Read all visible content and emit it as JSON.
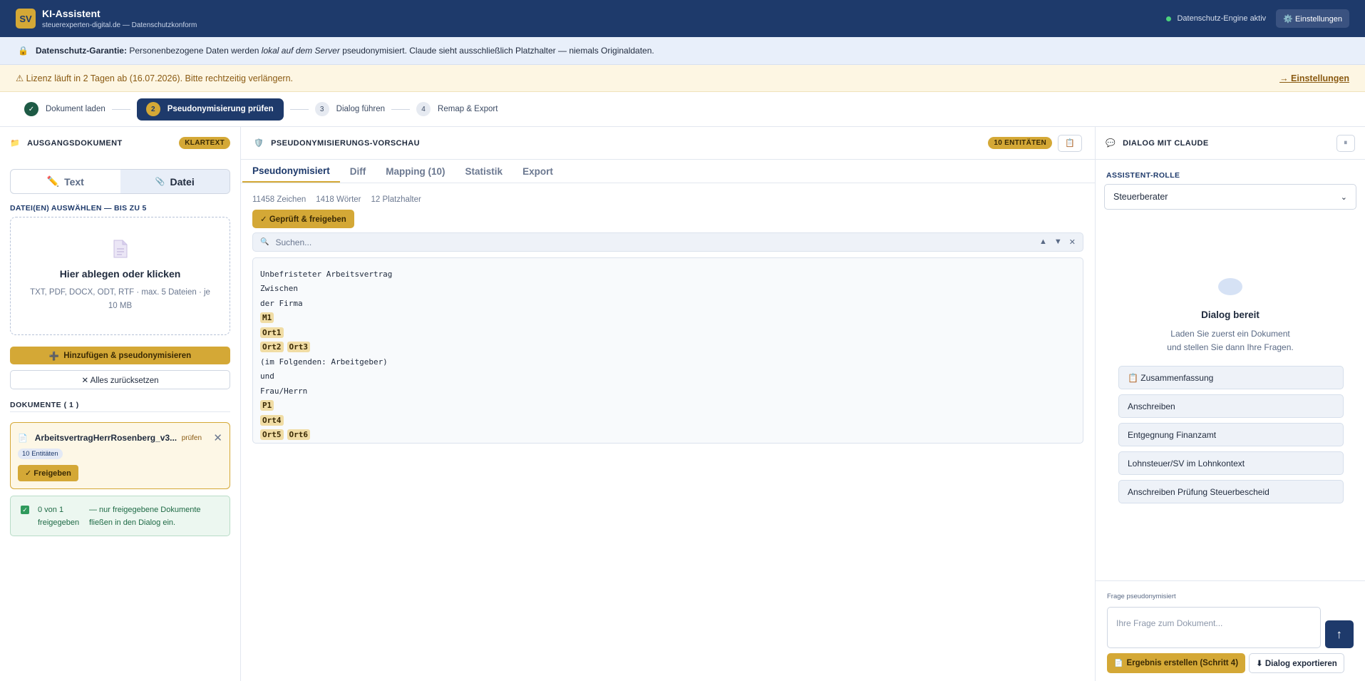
{
  "header": {
    "logo": "SV",
    "title": "KI-Assistent",
    "subtitle": "steuerexperten-digital.de — Datenschutzkonform",
    "engine_status": "Datenschutz-Engine aktiv",
    "settings_label": "⚙️ Einstellungen"
  },
  "privacy": {
    "bold": "Datenschutz-Garantie:",
    "text1": " Personenbezogene Daten werden ",
    "italic": "lokal auf dem Server",
    "text2": " pseudonymisiert. Claude sieht ausschließlich Platzhalter — niemals Originaldaten."
  },
  "license": {
    "text": "⚠ Lizenz läuft in 2 Tagen ab (16.07.2026). Bitte rechtzeitig verlängern.",
    "link": "→ Einstellungen"
  },
  "steps": [
    {
      "num": "✓",
      "label": "Dokument laden"
    },
    {
      "num": "2",
      "label": "Pseudonymisierung prüfen"
    },
    {
      "num": "3",
      "label": "Dialog führen"
    },
    {
      "num": "4",
      "label": "Remap & Export"
    }
  ],
  "left": {
    "title": "AUSGANGSDOKUMENT",
    "badge": "KLARTEXT",
    "tab_text": "Text",
    "tab_file": "Datei",
    "select_label": "DATEI(EN) AUSWÄHLEN — BIS ZU 5",
    "drop_title": "Hier ablegen oder klicken",
    "drop_sub": "TXT, PDF, DOCX, ODT, RTF · max. 5 Dateien · je 10 MB",
    "add_btn": "Hinzufügen & pseudonymisieren",
    "reset_btn": "✕ Alles zurücksetzen",
    "docs_label": "DOKUMENTE ( 1 )",
    "doc": {
      "name": "ArbeitsvertragHerrRosenberg_v3...",
      "status": "prüfen",
      "entities": "10 Entitäten",
      "free_btn": "✓ Freigeben"
    },
    "approved_count": "0 von 1 freigegeben",
    "approved_note": "— nur freigegebene Dokumente fließen in den Dialog ein."
  },
  "mid": {
    "title": "PSEUDONYMISIERUNGS-VORSCHAU",
    "entities_badge": "10 ENTITÄTEN",
    "tabs": [
      "Pseudonymisiert",
      "Diff",
      "Mapping (10)",
      "Statistik",
      "Export"
    ],
    "stats": {
      "chars": "11458 Zeichen",
      "words": "1418 Wörter",
      "placeholders": "12 Platzhalter"
    },
    "ok_btn": "✓ Geprüft & freigeben",
    "search_placeholder": "Suchen...",
    "lines": [
      "Unbefristeter Arbeitsvertrag",
      "Zwischen",
      "der Firma",
      "M1",
      "Ort1",
      "Ort2",
      "Ort3",
      "(im Folgenden: Arbeitgeber)",
      "und",
      "Frau/Herrn",
      "P1",
      "Ort4",
      "Ort5",
      "Ort6"
    ]
  },
  "right": {
    "title": "DIALOG MIT CLAUDE",
    "role_label": "ASSISTENT-ROLLE",
    "role_value": "Steuerberater",
    "empty_title": "Dialog bereit",
    "empty_sub1": "Laden Sie zuerst ein Dokument",
    "empty_sub2": "und stellen Sie dann Ihre Fragen.",
    "suggestions": [
      "📋 Zusammenfassung",
      "Anschreiben",
      "Entgegnung Finanzamt",
      "Lohnsteuer/SV im Lohnkontext",
      "Anschreiben Prüfung Steuerbescheid"
    ],
    "q_label": "Frage pseudonymisiert",
    "q_placeholder": "Ihre Frage zum Dokument...",
    "result_btn": "Ergebnis erstellen (Schritt 4)",
    "export_btn": "⬇ Dialog exportieren"
  }
}
